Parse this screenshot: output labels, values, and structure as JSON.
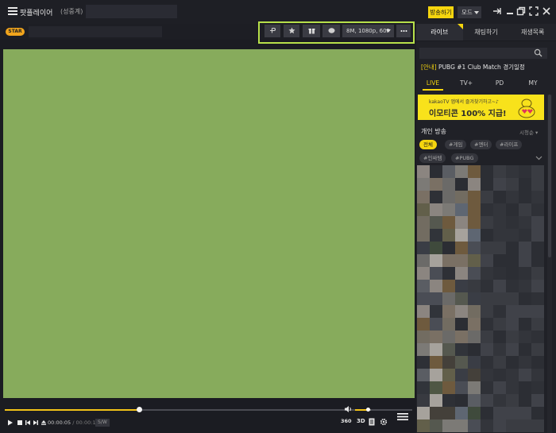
{
  "app": {
    "title": "팟플레이어",
    "status": "(성중계)"
  },
  "titlebar": {
    "broadcast_label": "방송하기",
    "mode_label": "모드"
  },
  "toolbar": {
    "star_badge": "STAR",
    "quality_label": "8M, 1080p, 60F"
  },
  "player": {
    "current_time": "00:00:05",
    "total_time": "/ 00:00:14",
    "speed_badge": "S/W",
    "seek_progress": 0.33,
    "volume_level": 0.8,
    "icon_360": "360",
    "icon_3d": "3D"
  },
  "sidebar": {
    "tabs": [
      {
        "label": "라이브"
      },
      {
        "label": "채팅하기"
      },
      {
        "label": "재생목록"
      }
    ],
    "notice": {
      "prefix": "[안내]",
      "text": " PUBG #1 Club Match 경기일정"
    },
    "subtabs": [
      {
        "label": "LIVE"
      },
      {
        "label": "TV+"
      },
      {
        "label": "PD"
      },
      {
        "label": "MY"
      }
    ],
    "banner": {
      "line1": "kakaoTV 앱에서 즐겨찾기하고~♪",
      "line2": "이모티콘 100% 지급!"
    },
    "section_title": "개인 방송",
    "sort_label": "시청순 ▾",
    "chips": [
      {
        "label": "전체"
      },
      {
        "label": "#게임"
      },
      {
        "label": "#엔터"
      },
      {
        "label": "#라이프"
      },
      {
        "label": "#인싸템"
      },
      {
        "label": "#PUBG"
      }
    ]
  },
  "colors": {
    "accent": "#f5d50e",
    "video_green": "#87ab5c",
    "highlight_border": "#b7e04a",
    "star_badge": "#f2a51c"
  },
  "icons": [
    "menu-icon",
    "pin-icon",
    "minimize-icon",
    "restore-icon",
    "fullscreen-icon",
    "close-icon",
    "star-icon",
    "gift-icon",
    "badge-icon",
    "more-icon",
    "search-icon",
    "volume-icon",
    "play-icon",
    "stop-icon",
    "prev-icon",
    "next-icon",
    "eject-icon",
    "playlist-icon",
    "gear-icon",
    "list-icon"
  ]
}
